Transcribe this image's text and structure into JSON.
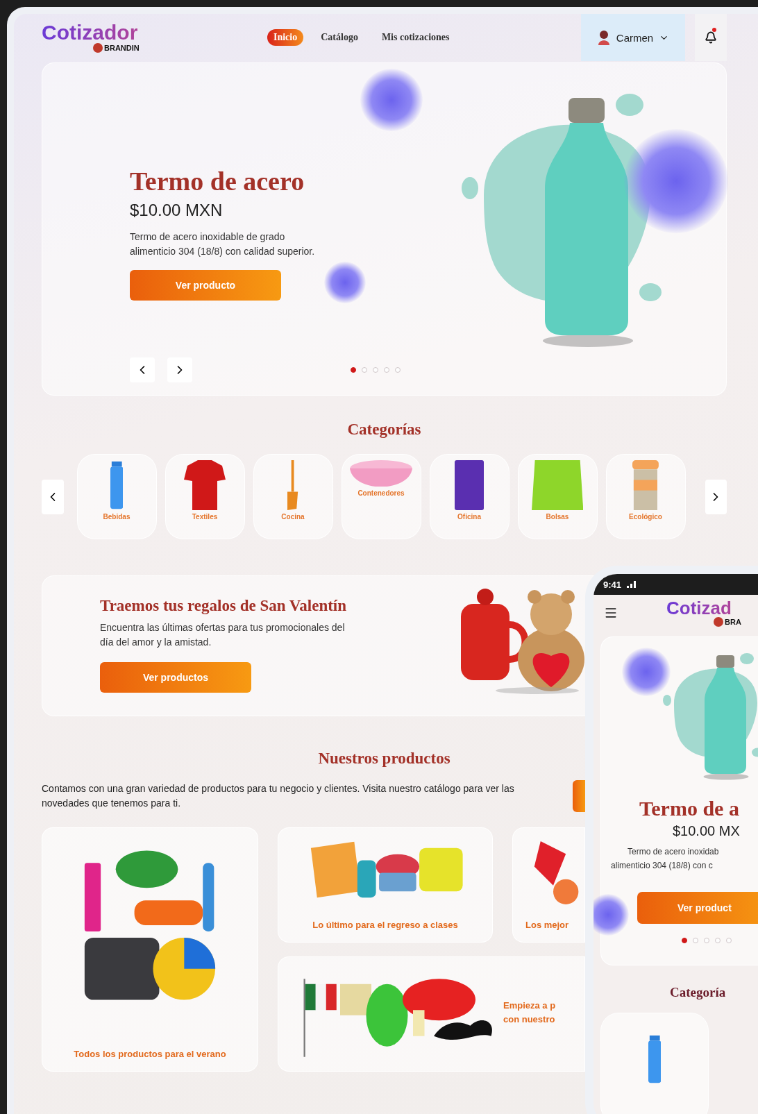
{
  "desktop": {
    "logo": {
      "name": "Cotizador",
      "sub": "BRANDIN"
    },
    "nav": [
      {
        "label": "Inicio",
        "selected": true
      },
      {
        "label": "Catálogo",
        "selected": false
      },
      {
        "label": "Mis cotizaciones",
        "selected": false
      }
    ],
    "user": {
      "name": "Carmen"
    },
    "notifications": {
      "unread": true
    },
    "hero": {
      "title": "Termo de acero",
      "price": "$10.00 MXN",
      "description": "Termo de acero inoxidable de grado alimenticio 304 (18/8) con calidad superior.",
      "button": "Ver producto",
      "dots": [
        {
          "selected": true
        },
        {
          "selected": false
        },
        {
          "selected": false
        },
        {
          "selected": false
        },
        {
          "selected": false
        }
      ]
    },
    "categories": {
      "title": "Categorías",
      "items": [
        {
          "label": "Bebidas"
        },
        {
          "label": "Textiles"
        },
        {
          "label": "Cocina"
        },
        {
          "label": "Contenedores"
        },
        {
          "label": "Oficina"
        },
        {
          "label": "Bolsas"
        },
        {
          "label": "Ecológico"
        }
      ]
    },
    "promo": {
      "title": "Traemos tus regalos de San Valentín",
      "text": "Encuentra las últimas ofertas para tus promocionales del día del amor y la amistad.",
      "button": "Ver productos"
    },
    "products": {
      "title": "Nuestros productos",
      "text": "Contamos con una gran variedad de productos para tu negocio y clientes. Visita nuestro catálogo para ver las novedades que tenemos para ti.",
      "cards": [
        {
          "lines": [
            "Todos los productos para el **verano**"
          ]
        },
        {
          "lines": [
            "Lo último para el **regreso a clases**"
          ]
        },
        {
          "lines": [
            "Los mejor"
          ]
        },
        {
          "lines": [
            "Empieza a p",
            "con nuestro"
          ]
        }
      ]
    }
  },
  "phone": {
    "time": "9:41",
    "logo": "Cotizad",
    "sub": "BRA",
    "title": "Termo de a",
    "price": "$10.00 MX",
    "description": [
      "Termo de acero inoxidab",
      "alimenticio 304 (18/8) con c"
    ],
    "button": "Ver product",
    "dots": [
      {
        "selected": true
      },
      {
        "selected": false
      },
      {
        "selected": false
      },
      {
        "selected": false
      },
      {
        "selected": false
      }
    ],
    "categories_title": "Categoría"
  }
}
